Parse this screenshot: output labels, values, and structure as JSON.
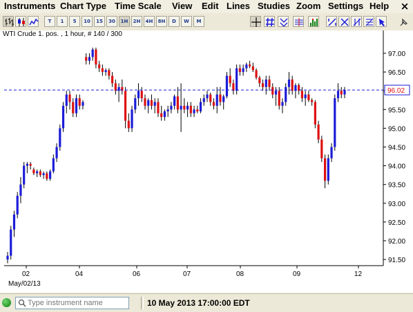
{
  "menubar": {
    "items": [
      "Instruments",
      "Chart Type",
      "Time Scale",
      "View",
      "Edit",
      "Lines",
      "Studies",
      "Zoom",
      "Settings",
      "Help"
    ],
    "close_glyph": "×"
  },
  "toolbar": {
    "timeframes": [
      "T",
      "1",
      "5",
      "10",
      "15",
      "30",
      "1H",
      "2H",
      "4H",
      "8H",
      "D",
      "W",
      "M"
    ],
    "selected_timeframe": "1H",
    "icons": [
      "bar-chart-icon",
      "candlestick-chart-icon",
      "line-chart-icon",
      "crosshair-icon",
      "grid-icon",
      "lines-icon",
      "studies-icon",
      "volume-icon",
      "draw-tool-icon",
      "cut-icon",
      "trend-tool-icon",
      "fibonacci-icon",
      "pointer-icon"
    ]
  },
  "chart": {
    "header": "WTI Crude 1. pos. , 1 hour, # 140 / 300",
    "current_price_label": "96.02",
    "date_label": "May/02/13"
  },
  "chart_data": {
    "type": "candlestick",
    "instrument": "WTI Crude 1. pos.",
    "interval": "1 hour",
    "ylim": [
      91.25,
      97.3
    ],
    "y_ticks": [
      "91.50",
      "92.00",
      "92.50",
      "93.00",
      "93.50",
      "94.00",
      "94.50",
      "95.00",
      "95.50",
      "96.00",
      "96.50",
      "97.00"
    ],
    "x_ticks": [
      "02",
      "04",
      "06",
      "07",
      "08",
      "09",
      "12"
    ],
    "current_price": 96.02,
    "colors": {
      "up": "#1c1cd8",
      "down": "#dd1111",
      "price_line": "#1c1cd8"
    },
    "ohlc": [
      [
        91.5,
        91.7,
        91.4,
        91.6
      ],
      [
        91.6,
        92.4,
        91.5,
        92.3
      ],
      [
        92.3,
        92.8,
        92.1,
        92.7
      ],
      [
        92.7,
        93.3,
        92.6,
        93.2
      ],
      [
        93.2,
        93.7,
        93.0,
        93.5
      ],
      [
        93.5,
        94.1,
        93.4,
        94.0
      ],
      [
        94.0,
        94.1,
        93.8,
        94.05
      ],
      [
        94.05,
        94.1,
        93.9,
        94.0
      ],
      [
        93.9,
        93.95,
        93.75,
        93.8
      ],
      [
        93.8,
        93.9,
        93.7,
        93.85
      ],
      [
        93.85,
        93.9,
        93.7,
        93.75
      ],
      [
        93.75,
        93.85,
        93.65,
        93.8
      ],
      [
        93.8,
        93.85,
        93.6,
        93.65
      ],
      [
        93.65,
        93.9,
        93.6,
        93.85
      ],
      [
        93.85,
        94.3,
        93.8,
        94.2
      ],
      [
        94.2,
        94.6,
        94.1,
        94.5
      ],
      [
        94.5,
        95.1,
        94.4,
        95.0
      ],
      [
        95.0,
        95.7,
        94.9,
        95.6
      ],
      [
        95.6,
        96.0,
        95.4,
        95.9
      ],
      [
        95.9,
        96.0,
        95.5,
        95.7
      ],
      [
        95.7,
        95.8,
        95.3,
        95.4
      ],
      [
        95.4,
        95.9,
        95.3,
        95.8
      ],
      [
        95.8,
        95.9,
        95.5,
        95.6
      ],
      [
        95.6,
        95.75,
        95.5,
        95.7
      ],
      [
        96.9,
        97.0,
        96.7,
        96.8
      ],
      [
        96.8,
        97.0,
        96.7,
        96.9
      ],
      [
        96.9,
        97.15,
        96.8,
        97.1
      ],
      [
        97.1,
        97.15,
        96.6,
        96.7
      ],
      [
        96.7,
        96.8,
        96.5,
        96.6
      ],
      [
        96.6,
        96.7,
        96.4,
        96.5
      ],
      [
        96.5,
        96.6,
        96.4,
        96.55
      ],
      [
        96.55,
        96.6,
        96.3,
        96.4
      ],
      [
        96.4,
        96.5,
        96.1,
        96.2
      ],
      [
        96.2,
        96.3,
        95.9,
        96.0
      ],
      [
        96.0,
        96.2,
        95.7,
        96.1
      ],
      [
        96.1,
        96.3,
        95.9,
        96.0
      ],
      [
        96.0,
        96.1,
        95.0,
        95.2
      ],
      [
        95.2,
        95.4,
        94.9,
        95.0
      ],
      [
        95.0,
        95.6,
        94.9,
        95.5
      ],
      [
        95.5,
        95.9,
        95.4,
        95.8
      ],
      [
        95.8,
        96.2,
        95.6,
        96.0
      ],
      [
        96.0,
        96.1,
        95.7,
        95.8
      ],
      [
        95.8,
        95.9,
        95.5,
        95.6
      ],
      [
        95.6,
        95.8,
        95.4,
        95.75
      ],
      [
        95.75,
        95.9,
        95.5,
        95.6
      ],
      [
        95.6,
        95.8,
        95.4,
        95.7
      ],
      [
        95.7,
        95.8,
        95.3,
        95.4
      ],
      [
        95.4,
        95.6,
        95.2,
        95.3
      ],
      [
        95.3,
        95.5,
        95.2,
        95.45
      ],
      [
        95.45,
        95.6,
        95.3,
        95.5
      ],
      [
        95.5,
        95.7,
        95.4,
        95.6
      ],
      [
        95.6,
        95.9,
        95.5,
        95.85
      ],
      [
        95.85,
        96.1,
        95.4,
        95.5
      ],
      [
        95.5,
        96.2,
        94.9,
        95.6
      ],
      [
        95.6,
        95.8,
        95.4,
        95.5
      ],
      [
        95.5,
        95.7,
        95.3,
        95.6
      ],
      [
        95.6,
        95.7,
        95.3,
        95.4
      ],
      [
        95.4,
        95.6,
        95.3,
        95.5
      ],
      [
        95.5,
        95.6,
        95.4,
        95.45
      ],
      [
        95.45,
        95.8,
        95.4,
        95.7
      ],
      [
        95.7,
        95.9,
        95.6,
        95.8
      ],
      [
        95.8,
        96.0,
        95.7,
        95.9
      ],
      [
        95.9,
        95.95,
        95.6,
        95.7
      ],
      [
        95.7,
        95.8,
        95.5,
        95.6
      ],
      [
        95.6,
        96.1,
        95.4,
        95.9
      ],
      [
        95.9,
        96.1,
        95.6,
        95.7
      ],
      [
        95.7,
        95.9,
        95.5,
        95.85
      ],
      [
        95.85,
        96.5,
        95.8,
        96.4
      ],
      [
        96.4,
        96.6,
        96.1,
        96.2
      ],
      [
        96.2,
        96.3,
        95.9,
        96.0
      ],
      [
        96.0,
        96.7,
        95.9,
        96.6
      ],
      [
        96.6,
        96.7,
        96.4,
        96.5
      ],
      [
        96.5,
        96.7,
        96.4,
        96.6
      ],
      [
        96.6,
        96.75,
        96.5,
        96.7
      ],
      [
        96.7,
        96.8,
        96.6,
        96.65
      ],
      [
        96.65,
        96.75,
        96.5,
        96.55
      ],
      [
        96.55,
        96.6,
        96.3,
        96.35
      ],
      [
        96.35,
        96.4,
        96.1,
        96.2
      ],
      [
        96.2,
        96.3,
        96.0,
        96.1
      ],
      [
        96.1,
        96.4,
        95.9,
        96.3
      ],
      [
        96.3,
        96.4,
        96.0,
        96.1
      ],
      [
        96.1,
        96.2,
        95.8,
        95.9
      ],
      [
        95.9,
        96.1,
        95.6,
        96.0
      ],
      [
        96.0,
        96.1,
        95.5,
        95.6
      ],
      [
        95.6,
        95.8,
        95.4,
        95.7
      ],
      [
        95.7,
        96.2,
        95.6,
        96.1
      ],
      [
        96.1,
        96.5,
        95.9,
        96.3
      ],
      [
        96.3,
        96.4,
        95.9,
        96.0
      ],
      [
        96.0,
        96.2,
        95.8,
        96.15
      ],
      [
        96.15,
        96.2,
        95.9,
        96.0
      ],
      [
        96.0,
        96.1,
        95.7,
        95.8
      ],
      [
        95.8,
        96.0,
        95.6,
        95.9
      ],
      [
        95.9,
        96.0,
        95.7,
        95.75
      ],
      [
        95.75,
        95.8,
        95.6,
        95.7
      ],
      [
        95.7,
        95.75,
        95.0,
        95.1
      ],
      [
        95.1,
        95.2,
        94.6,
        94.7
      ],
      [
        94.7,
        94.8,
        94.1,
        94.2
      ],
      [
        94.2,
        94.3,
        93.4,
        93.6
      ],
      [
        93.6,
        94.3,
        93.5,
        94.2
      ],
      [
        94.2,
        94.6,
        94.1,
        94.5
      ],
      [
        94.5,
        95.9,
        94.4,
        95.8
      ],
      [
        95.8,
        96.2,
        95.7,
        96.0
      ],
      [
        96.0,
        96.1,
        95.8,
        95.9
      ],
      [
        95.9,
        96.1,
        95.8,
        96.02
      ]
    ]
  },
  "status": {
    "search_placeholder": "Type instrument name",
    "datetime": "10 May 2013 17:00:00 EDT"
  }
}
